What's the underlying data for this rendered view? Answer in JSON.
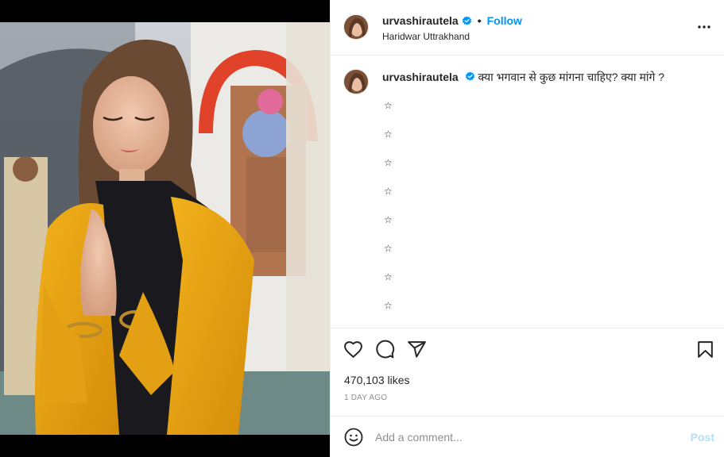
{
  "post": {
    "username": "urvashirautela",
    "follow_label": "Follow",
    "location": "Haridwar Uttrakhand",
    "separator": "•"
  },
  "caption": {
    "username": "urvashirautela",
    "text": "क्या भगवान से कुछ मांगना चाहिए? क्या मांगे ?",
    "stars": [
      "☆",
      "☆",
      "☆",
      "☆",
      "☆",
      "☆",
      "☆",
      "☆"
    ]
  },
  "stats": {
    "likes": "470,103 likes",
    "time": "1 DAY AGO"
  },
  "comment": {
    "placeholder": "Add a comment...",
    "post_label": "Post"
  },
  "icons": {
    "more": "more-horizontal-icon",
    "like": "heart-icon",
    "comment": "comment-icon",
    "share": "send-icon",
    "save": "bookmark-icon",
    "emoji": "emoji-icon",
    "verified": "verified-badge-icon"
  },
  "colors": {
    "accent": "#0095f6",
    "post_disabled": "#b2dffc",
    "verified": "#0095f6",
    "muted": "#8e8e8e"
  }
}
